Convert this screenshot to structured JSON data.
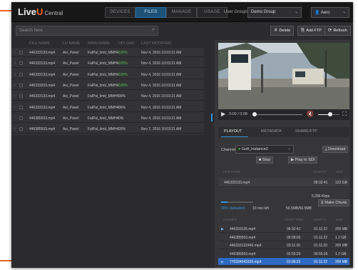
{
  "header": {
    "logo_main": "Live",
    "logo_u": "U",
    "logo_sub": "Central",
    "tabs": [
      "DEVICES",
      "FILES",
      "MANAGE",
      "USAGE"
    ],
    "active_tab": "FILES",
    "user_groups_label": "User Groups",
    "user_group_value": "Demo Group",
    "user_value": "Aero"
  },
  "toolbar": {
    "search_placeholder": "Search here",
    "delete": "Delete",
    "add_ftp": "Add FTP",
    "refresh": "Refresh"
  },
  "table": {
    "columns": [
      "FILE NAME",
      "LU NAME",
      "MAIN NAME",
      "UPLOAD",
      "LAST MODIFIED"
    ],
    "rows": [
      {
        "num": "1",
        "file": "446333133.mp4",
        "lu": "Avi_Panel",
        "main": "FalPal_limit_MMH4",
        "upload": "100%",
        "modified": "Nov 4, 2016 10:03:21 AM"
      },
      {
        "num": "2",
        "file": "446333133.mp4",
        "lu": "Avi_Panel",
        "main": "FalPal_limit_MMH4",
        "upload": "100%",
        "modified": "Nov 4, 2016 10:03:21 AM"
      },
      {
        "num": "3",
        "file": "446333133.mp4",
        "lu": "Avi_Panel",
        "main": "FalPal_limit_MMH4",
        "upload": "100%",
        "modified": "Nov 4, 2016 10:03:21 AM"
      },
      {
        "num": "4",
        "file": "446333203.mp4",
        "lu": "Avi_Panel",
        "main": "FalPal_limit_MMH4",
        "upload": "100%",
        "modified": "Nov 4, 2016 10:03:21 AM"
      },
      {
        "num": "5",
        "file": "446333133.mp4",
        "lu": "Avi_Panel",
        "main": "FalPal_limit_MMH4",
        "upload": "90%",
        "modified": "Nov 4, 2016 10:03:21 AM"
      },
      {
        "num": "6",
        "file": "446333133.mp4",
        "lu": "Avi_Panel",
        "main": "FalPal_limit_MMH4",
        "upload": "90%",
        "modified": "Nov 4, 2016 10:03:21 AM"
      },
      {
        "num": "7",
        "file": "446385503.mp4",
        "lu": "Avi_Panel",
        "main": "FalPal_limit_MMH4",
        "upload": "0%",
        "modified": "Nov 4, 2016 10:03:21 AM"
      },
      {
        "num": "8",
        "file": "446385503.mp4",
        "lu": "Avi_Panel",
        "main": "FalPal_limit_MMH4",
        "upload": "20%",
        "modified": "Nov 7, 2016 10:03:21 AM"
      }
    ]
  },
  "player": {
    "time": "0:00 / 0:08",
    "volume_progress": 0.55,
    "seek_progress": 0.0
  },
  "panel": {
    "tabs": [
      "PLAYOUT",
      "METADATA",
      "SHARE/FTP"
    ],
    "channel_label": "Channel",
    "channel_value": "Gulf_Instance2",
    "download": "Download",
    "stop": "Stop",
    "play_to_sdi": "Play to SDI",
    "file_cols": [
      "FILE NAME",
      "LENGTH",
      "SIZE"
    ],
    "file_name": "446333133.mp4",
    "file_length": "08:32:41",
    "file_size": "123 GB",
    "bitrate": "5,286 Kbps",
    "make_chunk": "Make Chunk",
    "upload_text": "20% Uploaded",
    "upload_time": "10 min left",
    "upload_size": "56.5MB/56.5MB",
    "upload_progress": 0.2,
    "chunk_cols": [
      "CHUNKS",
      "START TIME",
      "LENGTH",
      "SIZE"
    ],
    "chunks": [
      {
        "name": "446333135.mp4",
        "start": "06:32:41",
        "length": "01:11:22",
        "size": "200 MB",
        "arrow": true,
        "highlight": false
      },
      {
        "name": "446385503.mp4",
        "start": "05:08:06",
        "length": "01:11:22",
        "size": "1.2 GB",
        "arrow": false,
        "highlight": false
      },
      {
        "name": "446333132446.mp4",
        "start": "03:11:20",
        "length": "01:11:20",
        "size": "200 MB",
        "arrow": false,
        "highlight": false
      },
      {
        "name": "446385503.mp4",
        "start": "02:55:20",
        "length": "00:55:26",
        "size": "1.2 GB",
        "arrow": false,
        "highlight": false
      },
      {
        "name": "770334043155.mp4",
        "start": "01:06:22",
        "length": "01:11:22",
        "size": "200 MB",
        "arrow": true,
        "highlight": true
      }
    ]
  },
  "colors": {
    "accent": "#e8651d",
    "blue": "#3193e0",
    "green": "#52c152"
  }
}
